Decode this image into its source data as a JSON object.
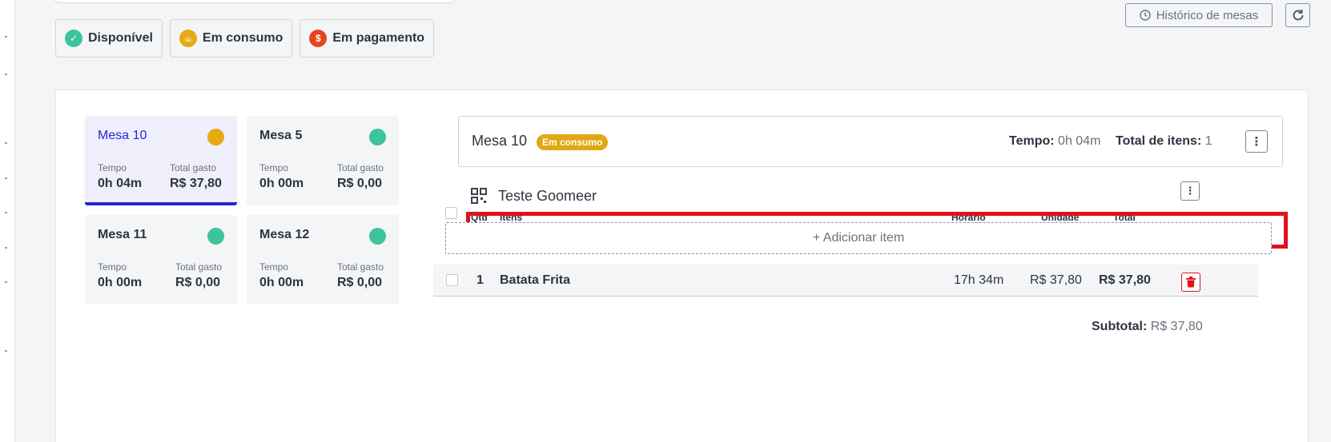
{
  "legend": [
    {
      "label": "Disponível",
      "icon": "check-circle-icon",
      "color": "#3cc49a",
      "glyph": "✓"
    },
    {
      "label": "Em consumo",
      "icon": "cup-icon",
      "color": "#e6aa12",
      "glyph": "☕"
    },
    {
      "label": "Em pagamento",
      "icon": "dollar-icon",
      "color": "#e8451f",
      "glyph": "$"
    }
  ],
  "toolbar": {
    "history_label": "Histórico de mesas",
    "history_icon": "clock-icon",
    "refresh_icon": "refresh-icon"
  },
  "tables": [
    {
      "name": "Mesa 10",
      "status_color": "#e6aa12",
      "time_label": "Tempo",
      "time": "0h 04m",
      "spent_label": "Total gasto",
      "spent": "R$ 37,80",
      "active": true
    },
    {
      "name": "Mesa 5",
      "status_color": "#3cc49a",
      "time_label": "Tempo",
      "time": "0h 00m",
      "spent_label": "Total gasto",
      "spent": "R$ 0,00",
      "active": false
    },
    {
      "name": "Mesa 11",
      "status_color": "#3cc49a",
      "time_label": "Tempo",
      "time": "0h 00m",
      "spent_label": "Total gasto",
      "spent": "R$ 0,00",
      "active": false
    },
    {
      "name": "Mesa 12",
      "status_color": "#3cc49a",
      "time_label": "Tempo",
      "time": "0h 00m",
      "spent_label": "Total gasto",
      "spent": "R$ 0,00",
      "active": false
    }
  ],
  "detail": {
    "title": "Mesa 10",
    "status": "Em consumo",
    "status_color": "#e0a816",
    "time_label": "Tempo:",
    "time_value": "0h 04m",
    "items_label": "Total de itens:",
    "items_value": "1"
  },
  "order": {
    "group_name": "Teste Goomeer",
    "group_icon": "qr-code-icon",
    "columns": {
      "qty": "Qtd",
      "items": "Itens",
      "time": "Horário",
      "unit": "Unidade",
      "total": "Total"
    },
    "add_item_label": "+ Adicionar item",
    "rows": [
      {
        "qty": "1",
        "item": "Batata Frita",
        "time": "17h 34m",
        "unit": "R$ 37,80",
        "total": "R$ 37,80"
      }
    ],
    "subtotal_label": "Subtotal:",
    "subtotal_value": "R$ 37,80"
  },
  "colors": {
    "accent": "#2626d6",
    "highlight_box": "#e0121d",
    "delete": "#e0121d"
  }
}
